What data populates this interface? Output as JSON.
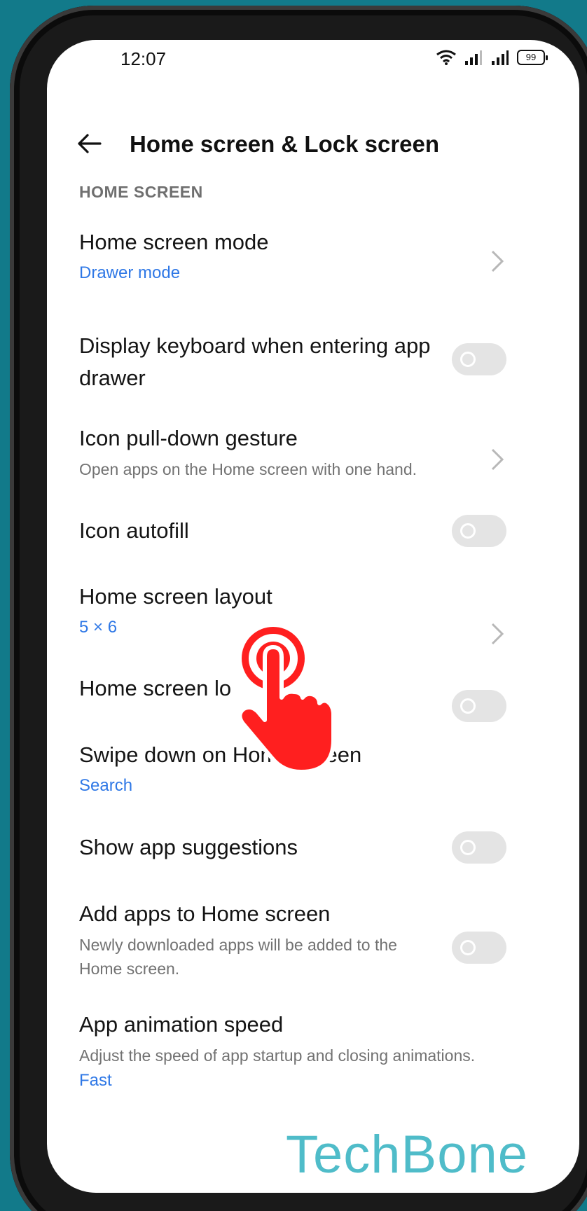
{
  "status_bar": {
    "time": "12:07",
    "battery": "99"
  },
  "header": {
    "title": "Home screen & Lock screen"
  },
  "section": {
    "label": "HOME SCREEN"
  },
  "rows": [
    {
      "title": "Home screen mode",
      "value": "Drawer mode",
      "control": "chevron"
    },
    {
      "title": "Display keyboard when entering app drawer",
      "control": "toggle",
      "on": false
    },
    {
      "title": "Icon pull-down gesture",
      "subtitle": "Open apps on the Home screen with one hand.",
      "control": "chevron"
    },
    {
      "title": "Icon autofill",
      "control": "toggle",
      "on": false
    },
    {
      "title": "Home screen layout",
      "value": "5 × 6",
      "control": "chevron"
    },
    {
      "title": "Home screen lo",
      "control": "toggle",
      "on": false
    },
    {
      "title": "Swipe down on Home screen",
      "value": "Search",
      "control": "none"
    },
    {
      "title": "Show app suggestions",
      "control": "toggle",
      "on": false
    },
    {
      "title": "Add apps to Home screen",
      "subtitle": "Newly downloaded apps will be added to the Home screen.",
      "control": "toggle",
      "on": false
    },
    {
      "title": "App animation speed",
      "subtitle": "Adjust the speed of app startup and closing animations.",
      "value": "Fast",
      "control": "none"
    }
  ],
  "overlay": {
    "watermark": "TechBone",
    "pointer_icon": "tap-hand-icon"
  },
  "colors": {
    "accent": "#2f78e6",
    "background": "#127a8a",
    "tap_red": "#ff1f1f",
    "watermark": "#4fbcc9"
  }
}
